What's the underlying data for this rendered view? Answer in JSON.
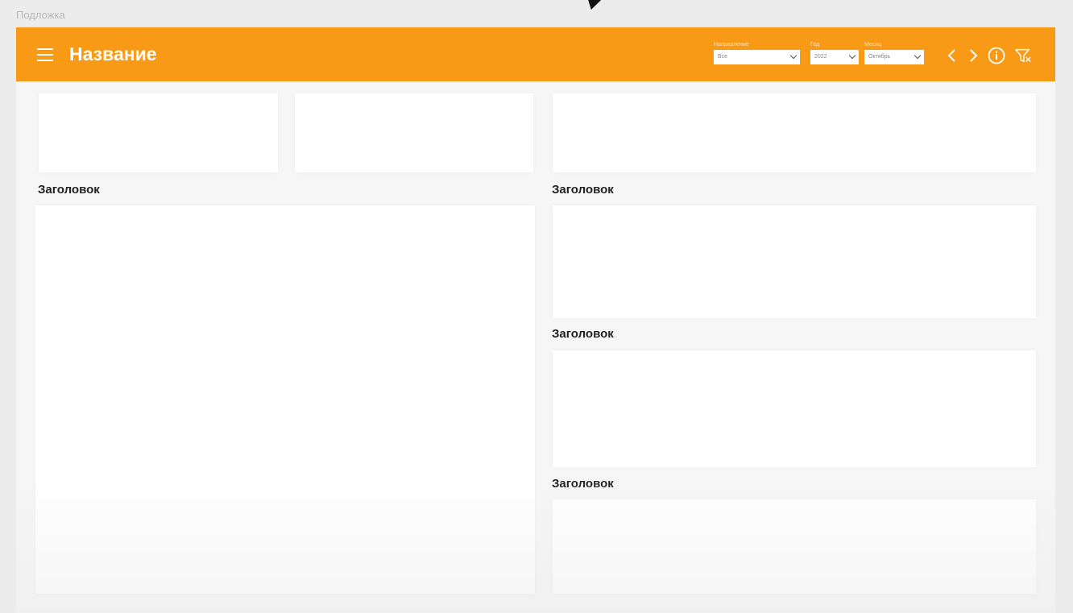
{
  "backdrop": {
    "label": "Подложка"
  },
  "header": {
    "title": "Название",
    "menu_icon": "hamburger-icon",
    "filters": [
      {
        "label": "Направление",
        "value": "Все"
      },
      {
        "label": "Год",
        "value": "2022"
      },
      {
        "label": "Месяц",
        "value": "Октябрь"
      }
    ],
    "icons": [
      "chevron-left-icon",
      "chevron-right-icon",
      "info-icon",
      "filter-clear-icon"
    ]
  },
  "sections": [
    {
      "title": "Заголовок"
    },
    {
      "title": "Заголовок"
    },
    {
      "title": "Заголовок"
    },
    {
      "title": "Заголовок"
    }
  ],
  "colors": {
    "header": "#f99a17",
    "background": "#ececec",
    "card": "#ffffff"
  }
}
